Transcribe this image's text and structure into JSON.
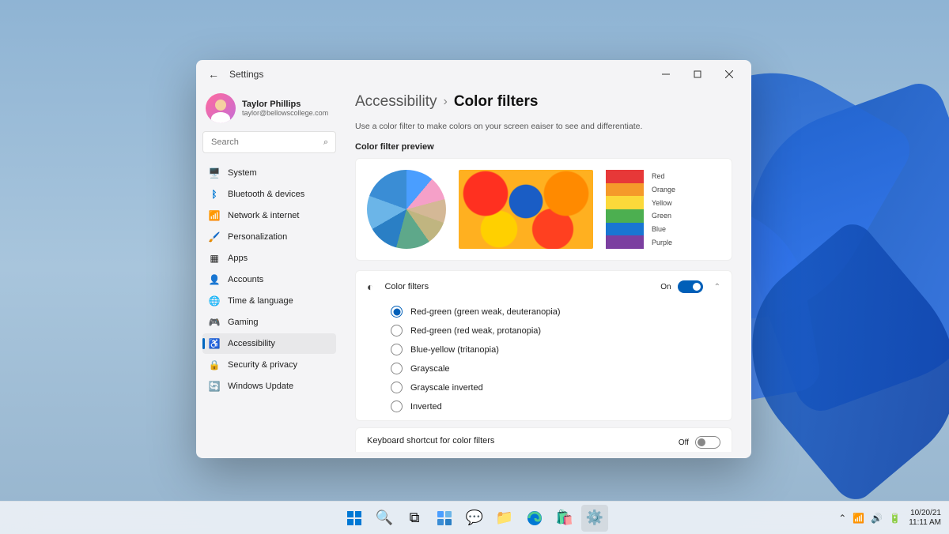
{
  "taskbar": {
    "date": "10/20/21",
    "time": "11:11 AM"
  },
  "window": {
    "app_title": "Settings"
  },
  "profile": {
    "name": "Taylor Phillips",
    "email": "taylor@bellowscollege.com"
  },
  "search": {
    "placeholder": "Search"
  },
  "nav": {
    "items": [
      {
        "label": "System",
        "icon": "🖥️"
      },
      {
        "label": "Bluetooth & devices",
        "icon": "ᛒ"
      },
      {
        "label": "Network & internet",
        "icon": "📶"
      },
      {
        "label": "Personalization",
        "icon": "🖌️"
      },
      {
        "label": "Apps",
        "icon": "▦"
      },
      {
        "label": "Accounts",
        "icon": "👤"
      },
      {
        "label": "Time & language",
        "icon": "🌐"
      },
      {
        "label": "Gaming",
        "icon": "🎮"
      },
      {
        "label": "Accessibility",
        "icon": "♿"
      },
      {
        "label": "Security & privacy",
        "icon": "🔒"
      },
      {
        "label": "Windows Update",
        "icon": "🔄"
      }
    ]
  },
  "breadcrumb": {
    "parent": "Accessibility",
    "current": "Color filters"
  },
  "description": "Use a color filter to make colors on your screen eaiser to see and differentiate.",
  "preview": {
    "title": "Color filter preview",
    "palette_labels": [
      "Red",
      "Orange",
      "Yellow",
      "Green",
      "Blue",
      "Purple"
    ]
  },
  "filter_setting": {
    "title": "Color filters",
    "state_label": "On",
    "options": [
      "Red-green (green weak, deuteranopia)",
      "Red-green (red weak, protanopia)",
      "Blue-yellow (tritanopia)",
      "Grayscale",
      "Grayscale inverted",
      "Inverted"
    ]
  },
  "shortcut": {
    "title": "Keyboard shortcut for color filters",
    "state_label": "Off"
  }
}
